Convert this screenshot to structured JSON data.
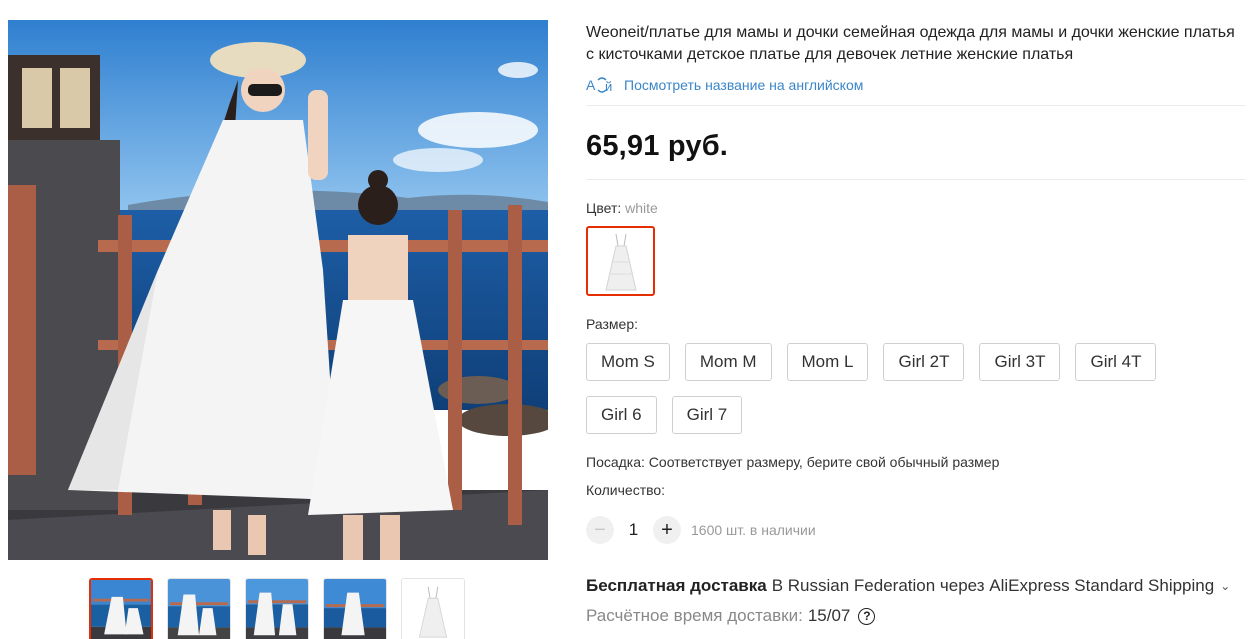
{
  "product": {
    "title": "Weoneit/платье для мамы и дочки семейная одежда для мамы и дочки женские платья с кисточками детское платье для девочек летние женские платья",
    "translate_link": "Посмотреть название на английском",
    "price": "65,91 руб."
  },
  "color": {
    "label": "Цвет:",
    "selected": "white"
  },
  "size": {
    "label": "Размер:",
    "options": [
      "Mom S",
      "Mom M",
      "Mom L",
      "Girl 2T",
      "Girl 3T",
      "Girl 4T",
      "Girl 6",
      "Girl 7"
    ]
  },
  "fit": "Посадка: Соответствует размеру, берите свой обычный размер",
  "quantity": {
    "label": "Количество:",
    "value": "1",
    "minus": "−",
    "plus": "+",
    "stock": "1600 шт. в наличии"
  },
  "shipping": {
    "free": "Бесплатная доставка",
    "details": "В Russian Federation через AliExpress Standard Shipping",
    "delivery_label": "Расчётное время доставки:",
    "delivery_date": "15/07",
    "help": "?"
  },
  "gallery": {
    "thumbnails": [
      "photo-1",
      "photo-2",
      "photo-3",
      "photo-4",
      "photo-5"
    ],
    "active_index": 0
  },
  "colors": {
    "accent": "#e62e04",
    "link": "#3a86c8",
    "sky": "#3f8fd6",
    "sea": "#1a5fa0"
  }
}
